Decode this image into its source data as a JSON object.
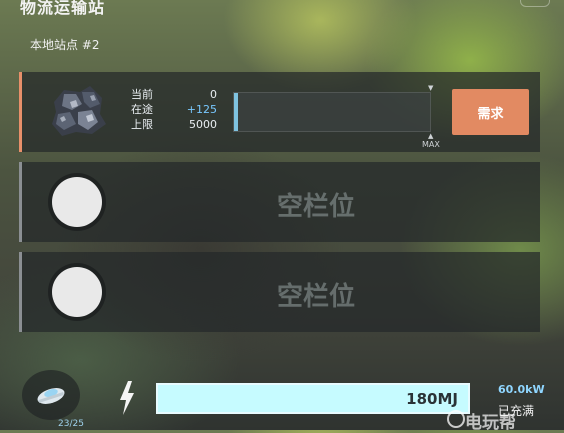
{
  "header": {
    "title": "物流运输站",
    "subtitle": "本地站点 #2"
  },
  "slots": [
    {
      "state": "filled",
      "item_icon": "ore-chunk-icon",
      "stats": [
        {
          "label": "当前",
          "value": "0"
        },
        {
          "label": "在途",
          "value": "+125"
        },
        {
          "label": "上限",
          "value": "5000"
        }
      ],
      "storage_fill_fraction": 0.02,
      "max_label": "MAX",
      "action_label": "需求",
      "accent_color": "#e28a62"
    },
    {
      "state": "empty",
      "label": "空栏位"
    },
    {
      "state": "empty",
      "label": "空栏位"
    }
  ],
  "footer": {
    "drone_icon": "drone-icon",
    "drone_count": "23/25",
    "bolt_icon": "lightning-icon",
    "energy_label": "180MJ",
    "energy_fill_fraction": 1.0,
    "power": "60.0kW",
    "status": "已充满",
    "watermark": "电玩帮"
  }
}
